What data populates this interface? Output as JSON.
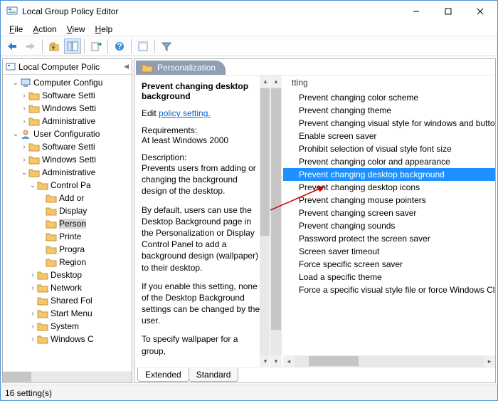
{
  "window": {
    "title": "Local Group Policy Editor"
  },
  "menubar": {
    "file": "File",
    "action": "Action",
    "view": "View",
    "help": "Help"
  },
  "tree": {
    "header": "Local Computer Polic",
    "items": [
      {
        "depth": 0,
        "expand": "v",
        "icon": "computer",
        "label": "Computer Configu"
      },
      {
        "depth": 1,
        "expand": ">",
        "icon": "folder",
        "label": "Software Setti"
      },
      {
        "depth": 1,
        "expand": ">",
        "icon": "folder",
        "label": "Windows Setti"
      },
      {
        "depth": 1,
        "expand": ">",
        "icon": "folder",
        "label": "Administrative"
      },
      {
        "depth": 0,
        "expand": "v",
        "icon": "user",
        "label": "User Configuratio"
      },
      {
        "depth": 1,
        "expand": ">",
        "icon": "folder",
        "label": "Software Setti"
      },
      {
        "depth": 1,
        "expand": ">",
        "icon": "folder",
        "label": "Windows Setti"
      },
      {
        "depth": 1,
        "expand": "v",
        "icon": "folder",
        "label": "Administrative"
      },
      {
        "depth": 2,
        "expand": "v",
        "icon": "folder",
        "label": "Control Pa"
      },
      {
        "depth": 3,
        "expand": "",
        "icon": "folder",
        "label": "Add or"
      },
      {
        "depth": 3,
        "expand": "",
        "icon": "folder",
        "label": "Display"
      },
      {
        "depth": 3,
        "expand": "",
        "icon": "folder",
        "label": "Person",
        "selected": true
      },
      {
        "depth": 3,
        "expand": "",
        "icon": "folder",
        "label": "Printe"
      },
      {
        "depth": 3,
        "expand": "",
        "icon": "folder",
        "label": "Progra"
      },
      {
        "depth": 3,
        "expand": "",
        "icon": "folder",
        "label": "Region"
      },
      {
        "depth": 2,
        "expand": ">",
        "icon": "folder",
        "label": "Desktop"
      },
      {
        "depth": 2,
        "expand": ">",
        "icon": "folder",
        "label": "Network"
      },
      {
        "depth": 2,
        "expand": "",
        "icon": "folder",
        "label": "Shared Fol"
      },
      {
        "depth": 2,
        "expand": ">",
        "icon": "folder",
        "label": "Start Menu"
      },
      {
        "depth": 2,
        "expand": ">",
        "icon": "folder",
        "label": "System"
      },
      {
        "depth": 2,
        "expand": ">",
        "icon": "folder",
        "label": "Windows C"
      }
    ]
  },
  "folder_header": "Personalization",
  "detail": {
    "heading": "Prevent changing desktop background",
    "edit_label": "Edit",
    "edit_link": "policy setting.",
    "req_label": "Requirements:",
    "req_value": "At least Windows 2000",
    "desc_label": "Description:",
    "desc_p1": "Prevents users from adding or changing the background design of the desktop.",
    "desc_p2": "By default, users can use the Desktop Background page in the Personalization or Display Control Panel to add a background design (wallpaper) to their desktop.",
    "desc_p3": "If you enable this setting, none of the Desktop Background settings can be changed by the user.",
    "desc_p4": "To specify wallpaper for a group,"
  },
  "list": {
    "header": "tting",
    "items": [
      "Prevent changing color scheme",
      "Prevent changing theme",
      "Prevent changing visual style for windows and butto",
      "Enable screen saver",
      "Prohibit selection of visual style font size",
      "Prevent changing color and appearance",
      "Prevent changing desktop background",
      "Prevent changing desktop icons",
      "Prevent changing mouse pointers",
      "Prevent changing screen saver",
      "Prevent changing sounds",
      "Password protect the screen saver",
      "Screen saver timeout",
      "Force specific screen saver",
      "Load a specific theme",
      "Force a specific visual style file or force Windows Clas"
    ],
    "selected_index": 6
  },
  "bottom_tabs": {
    "extended": "Extended",
    "standard": "Standard",
    "active": "extended"
  },
  "status": "16 setting(s)"
}
